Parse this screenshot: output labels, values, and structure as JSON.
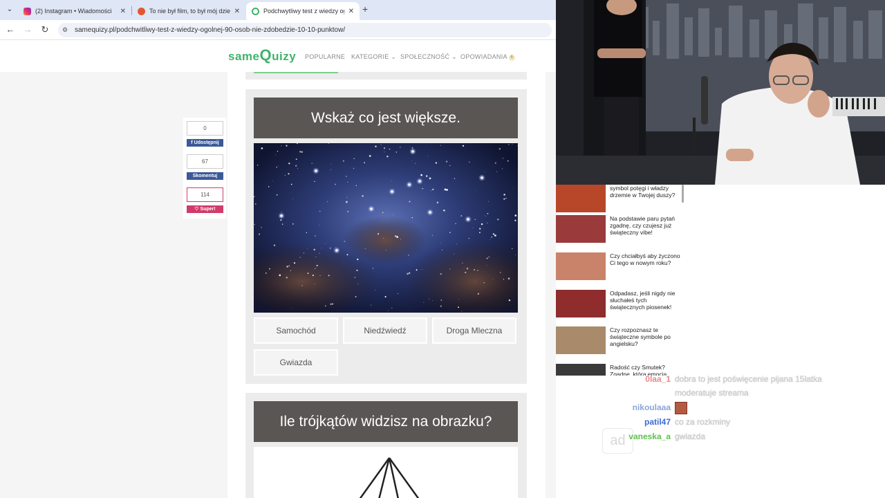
{
  "browser": {
    "tabs": [
      {
        "title": "(2) Instagram • Wiadomości",
        "favicon_color": "#d6249f"
      },
      {
        "title": "To nie był film, to był mój dzień",
        "favicon_color": "#e4572e"
      },
      {
        "title": "Podchwytliwy test z wiedzy ogólnej",
        "favicon_color": "#3fb36b"
      }
    ],
    "new_tab_label": "+",
    "url": "samequizy.pl/podchwitliwy-test-z-wiedzy-ogolnej-90-osob-nie-zdobedzie-10-10-punktow/"
  },
  "site": {
    "logo_same": "same",
    "logo_q": "Q",
    "logo_uizy": "uizy",
    "menu": [
      "POPULARNE",
      "KATEGORIE",
      "SPOŁECZNOŚĆ",
      "OPOWIADANIA"
    ],
    "menu_badge": "6",
    "chevron": "⌄",
    "brand_color": "#3fb36b"
  },
  "share": {
    "share_count": "0",
    "share_label": "Udostępnij",
    "comment_count": "67",
    "comment_label": "Skomentuj",
    "like_count": "114",
    "like_label": "Super!"
  },
  "quiz": {
    "question1": {
      "title": "Wskaż co jest większe.",
      "answers": [
        "Samochód",
        "Niedźwiedź",
        "Droga Mleczna",
        "Gwiazda"
      ]
    },
    "question2": {
      "title": "Ile trójkątów widzisz na obrazku?"
    }
  },
  "recommendations": [
    {
      "text": "symbol potęgi i władzy drzemie w Twojej duszy?",
      "thumb_color": "#b8472a"
    },
    {
      "text": "Na podstawie paru pytań zgadnę, czy czujesz już świąteczny vibe!",
      "thumb_color": "#9a3a3a"
    },
    {
      "text": "Czy chciałbyś aby życzono Ci tego w nowym roku?",
      "thumb_color": "#c9836a"
    },
    {
      "text": "Odpadasz, jeśli nigdy nie słuchałeś tych świątecznych piosenek!",
      "thumb_color": "#8f2c2c"
    },
    {
      "text": "Czy rozpoznasz te świąteczne symbole po angielsku?",
      "thumb_color": "#a98a6a"
    },
    {
      "text": "Radość czy Smutek? Zgadnę, która emocja",
      "thumb_color": "#3a3a3a"
    }
  ],
  "chat": [
    {
      "user": "0laa_1",
      "user_color": "#e58a8a",
      "text": "dobra to jest poświęcenie pijana 15latka"
    },
    {
      "user": "",
      "user_color": "#ffffff",
      "text": "moderatuje streama"
    },
    {
      "user": "nikoulaaa",
      "user_color": "#8aa6d8",
      "text": ""
    },
    {
      "user": "patil47",
      "user_color": "#3a6ad8",
      "text": "co za rozkminy"
    },
    {
      "user": "vaneska_a",
      "user_color": "#5ec24a",
      "text": "gwiazda"
    }
  ],
  "ad_label": "ad"
}
